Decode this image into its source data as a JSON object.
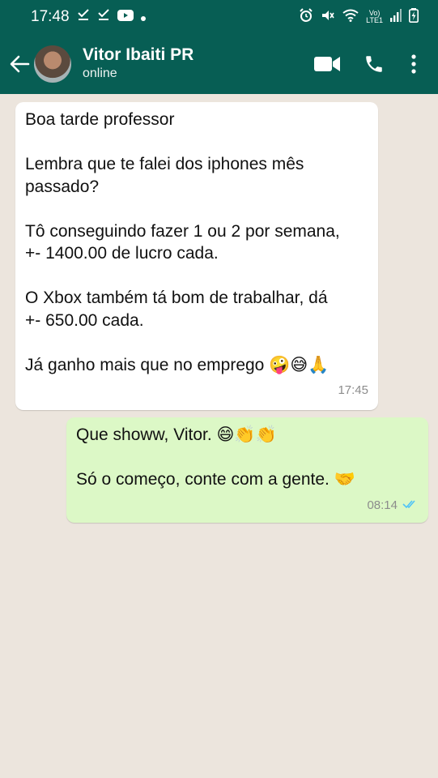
{
  "status_bar": {
    "time": "17:48",
    "left_icons": [
      "check-download-icon",
      "check-download-icon",
      "youtube-icon",
      "dot-icon"
    ],
    "right_icons": [
      "alarm-icon",
      "mute-icon",
      "wifi-icon",
      "volte-lte-icon",
      "signal-icon",
      "battery-icon"
    ],
    "volte_label": "Vo)\nLTE1"
  },
  "header": {
    "contact_name": "Vitor Ibaiti PR",
    "contact_status": "online",
    "actions": [
      "video-call-icon",
      "voice-call-icon",
      "menu-icon"
    ]
  },
  "messages": [
    {
      "direction": "incoming",
      "lines": [
        "Boa tarde professor",
        "",
        "Lembra que te falei dos iphones mês",
        "passado?",
        "",
        "Tô conseguindo fazer 1 ou 2 por semana,",
        "+- 1400.00 de lucro cada.",
        "",
        "O Xbox também tá bom de trabalhar, dá",
        "+- 650.00 cada.",
        "",
        "Já ganho mais que no emprego 🤪😅🙏"
      ],
      "time": "17:45"
    },
    {
      "direction": "outgoing",
      "lines": [
        "Que showw, Vitor. 😄👏👏",
        "",
        "Só o começo, conte com a gente. 🤝"
      ],
      "time": "08:14",
      "read_status": "read-double-check"
    }
  ],
  "colors": {
    "header_bg": "#075e54",
    "chat_bg": "#ece5dd",
    "incoming_bubble": "#ffffff",
    "outgoing_bubble": "#dcf8c6",
    "read_tick": "#4fc3f7"
  }
}
